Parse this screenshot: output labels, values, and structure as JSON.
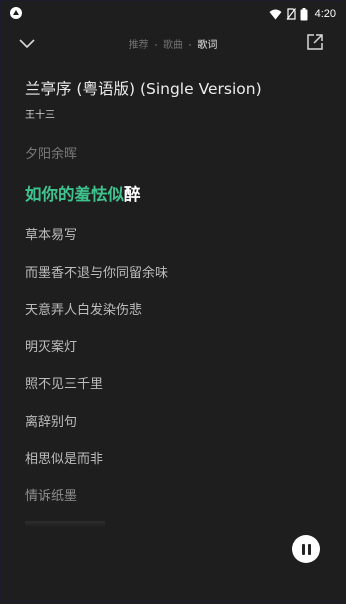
{
  "status_bar": {
    "time": "4:20"
  },
  "header": {
    "tabs": [
      {
        "label": "推荐",
        "active": false
      },
      {
        "label": "歌曲",
        "active": false
      },
      {
        "label": "歌词",
        "active": true
      }
    ]
  },
  "song": {
    "title": "兰亭序 (粤语版) (Single Version)",
    "artist": "王十三"
  },
  "lyrics": {
    "previous": "夕阳余晖",
    "current_sung": "如你的羞怯似",
    "current_unsung": "醉",
    "upcoming": [
      "草本易写",
      "而墨香不退与你同留余味",
      "天意弄人白发染伤悲",
      "明灭案灯",
      "照不见三千里",
      "离辞别句",
      "相思似是而非",
      "情诉纸墨"
    ]
  },
  "colors": {
    "accent": "#3fc38e",
    "background": "#1e1e1e"
  }
}
